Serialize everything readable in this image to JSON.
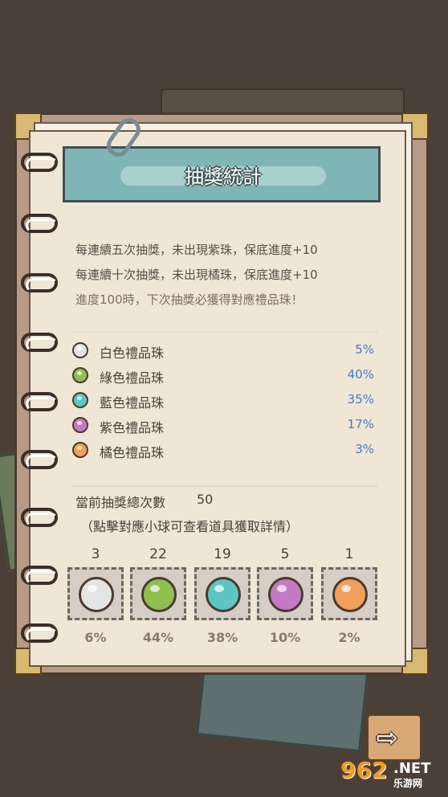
{
  "header": {
    "title": "抽獎統計"
  },
  "rules": [
    "每連續五次抽獎，未出現紫珠，保底進度+10",
    "每連續十次抽獎，未出現橘珠，保底進度+10",
    "進度100時，下次抽獎必獲得對應禮品珠！"
  ],
  "rates": [
    {
      "name": "白色禮品珠",
      "pct": "5%",
      "color": "#e4e4e4"
    },
    {
      "name": "綠色禮品珠",
      "pct": "40%",
      "color": "#8fbf4f"
    },
    {
      "name": "藍色禮品珠",
      "pct": "35%",
      "color": "#5fc4c4"
    },
    {
      "name": "紫色禮品珠",
      "pct": "17%",
      "color": "#c47ac4"
    },
    {
      "name": "橘色禮品珠",
      "pct": "3%",
      "color": "#f0a05a"
    }
  ],
  "summary": {
    "total_label": "當前抽獎總次數",
    "total_value": "50",
    "hint": "（點擊對應小球可查看道具獲取詳情）"
  },
  "results": [
    {
      "count": "3",
      "share": "6%",
      "color": "#e4e4e4"
    },
    {
      "count": "22",
      "share": "44%",
      "color": "#8fbf4f"
    },
    {
      "count": "19",
      "share": "38%",
      "color": "#5fc4c4"
    },
    {
      "count": "5",
      "share": "10%",
      "color": "#c47ac4"
    },
    {
      "count": "1",
      "share": "2%",
      "color": "#f0a05a"
    }
  ],
  "next_button": {
    "icon": "arrow-right-icon",
    "glyph": "⇨"
  },
  "watermark": {
    "number": "962",
    "domain": ".NET",
    "site": "乐游网"
  }
}
